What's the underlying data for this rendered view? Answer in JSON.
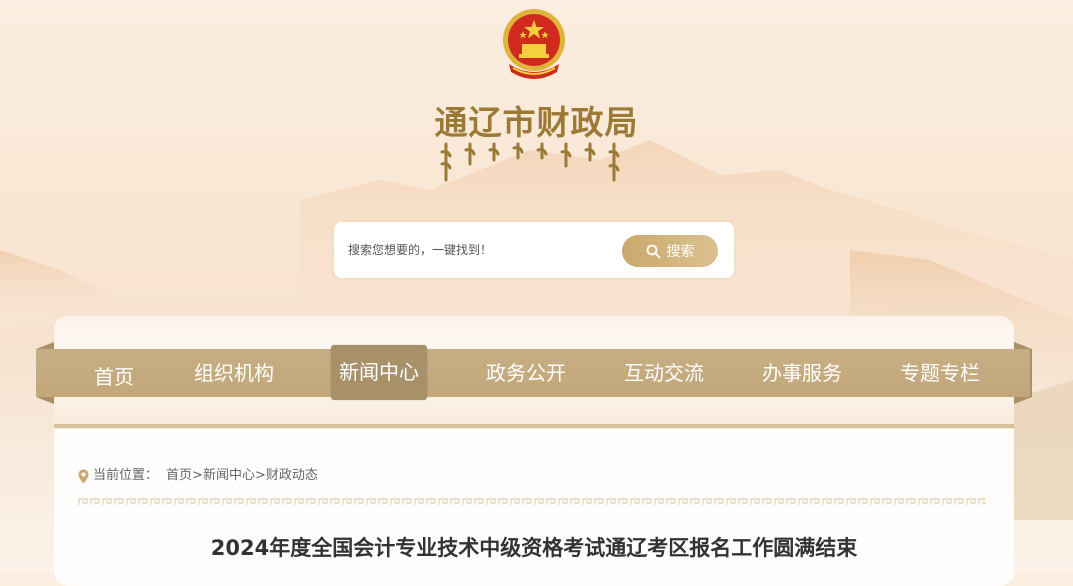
{
  "header": {
    "site_title": "通辽市财政局",
    "emblem_icon": "national-emblem-icon",
    "mongolian_script_icon": "mongolian-script-title"
  },
  "search": {
    "placeholder": "搜索您想要的，一键找到！",
    "button_label": "搜索",
    "button_icon": "search-icon"
  },
  "nav": {
    "items": [
      {
        "label": "首页",
        "active": false
      },
      {
        "label": "组织机构",
        "active": false
      },
      {
        "label": "新闻中心",
        "active": true
      },
      {
        "label": "政务公开",
        "active": false
      },
      {
        "label": "互动交流",
        "active": false
      },
      {
        "label": "办事服务",
        "active": false
      },
      {
        "label": "专题专栏",
        "active": false
      }
    ]
  },
  "breadcrumb": {
    "icon": "location-pin-icon",
    "prefix": "当前位置：",
    "items": [
      "首页",
      "新闻中心",
      "财政动态"
    ],
    "separator": ">"
  },
  "article": {
    "title": "2024年度全国会计专业技术中级资格考试通辽考区报名工作圆满结束"
  },
  "colors": {
    "accent_gold": "#9c7a36",
    "nav_bg": "#c6ae84",
    "nav_active": "#a89168",
    "search_button": "#d2b47e"
  }
}
